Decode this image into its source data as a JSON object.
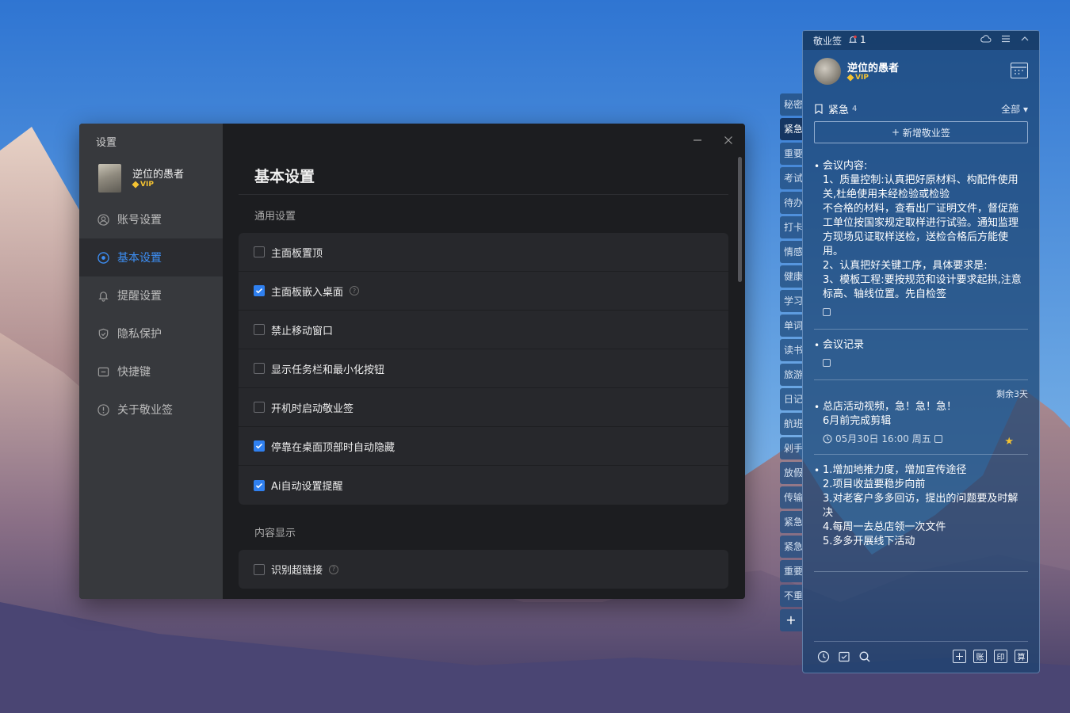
{
  "settings": {
    "window_title": "设置",
    "user": {
      "name": "逆位的愚者",
      "badge": "VIP"
    },
    "nav": [
      {
        "label": "账号设置",
        "icon": "user-icon"
      },
      {
        "label": "基本设置",
        "icon": "target-icon"
      },
      {
        "label": "提醒设置",
        "icon": "bell-icon"
      },
      {
        "label": "隐私保护",
        "icon": "shield-icon"
      },
      {
        "label": "快捷键",
        "icon": "keyboard-icon"
      },
      {
        "label": "关于敬业签",
        "icon": "info-icon"
      }
    ],
    "active_nav": "基本设置",
    "page_title": "基本设置",
    "general": {
      "label": "通用设置",
      "options": [
        {
          "label": "主面板置顶",
          "checked": false
        },
        {
          "label": "主面板嵌入桌面",
          "checked": true,
          "help": true
        },
        {
          "label": "禁止移动窗口",
          "checked": false
        },
        {
          "label": "显示任务栏和最小化按钮",
          "checked": false
        },
        {
          "label": "开机时启动敬业签",
          "checked": false
        },
        {
          "label": "停靠在桌面顶部时自动隐藏",
          "checked": true
        },
        {
          "label": "Ai自动设置提醒",
          "checked": true
        }
      ]
    },
    "content": {
      "label": "内容显示",
      "options": [
        {
          "label": "识别超链接",
          "checked": false,
          "help": true
        }
      ]
    }
  },
  "notes_panel": {
    "app_name": "敬业签",
    "notification_count": "1",
    "user": {
      "name": "逆位的愚者",
      "badge": "VIP"
    },
    "category": {
      "name": "紧急",
      "count": "4",
      "filter": "全部"
    },
    "new_button": "新增敬业签",
    "notes": [
      {
        "lines": [
          "会议内容:",
          "1、质量控制:认真把好原材料、构配件使用",
          "关,杜绝使用未经检验或检验",
          "不合格的材料，查看出厂证明文件，督促施",
          "工单位按国家规定取样进行试验。通知监理",
          "方现场见证取样送检，送检合格后方能使",
          "用。",
          "2、认真把好关键工序，具体要求是:",
          "3、模板工程:要按规范和设计要求起拱,注意",
          "标高、轴线位置。先自检签"
        ]
      },
      {
        "lines": [
          "会议记录"
        ]
      },
      {
        "remaining": "剩余3天",
        "lines": [
          "总店活动视频，急！急！急！",
          "6月前完成剪辑"
        ],
        "meta": "05月30日 16:00 周五"
      },
      {
        "lines": [
          "1.增加地推力度，增加宣传途径",
          "2.项目收益要稳步向前",
          "3.对老客户多多回访，提出的问题要及时解",
          "决",
          "4.每周一去总店领一次文件",
          "5.多多开展线下活动"
        ]
      }
    ],
    "tabs": [
      "秘密",
      "紧急",
      "重要",
      "考试",
      "待办",
      "打卡",
      "情感",
      "健康",
      "学习",
      "单词",
      "读书",
      "旅游",
      "日记",
      "航班",
      "剁手",
      "放假",
      "传输",
      "紧急",
      "紧急",
      "重要",
      "不重"
    ],
    "active_tab": "紧急",
    "bottom_tools": [
      "账",
      "印",
      "算"
    ]
  },
  "colors": {
    "accent": "#2f80f0",
    "vip": "#f3c232",
    "settings_bg": "#1c1d20",
    "sidebar_bg": "#3a3c40"
  }
}
